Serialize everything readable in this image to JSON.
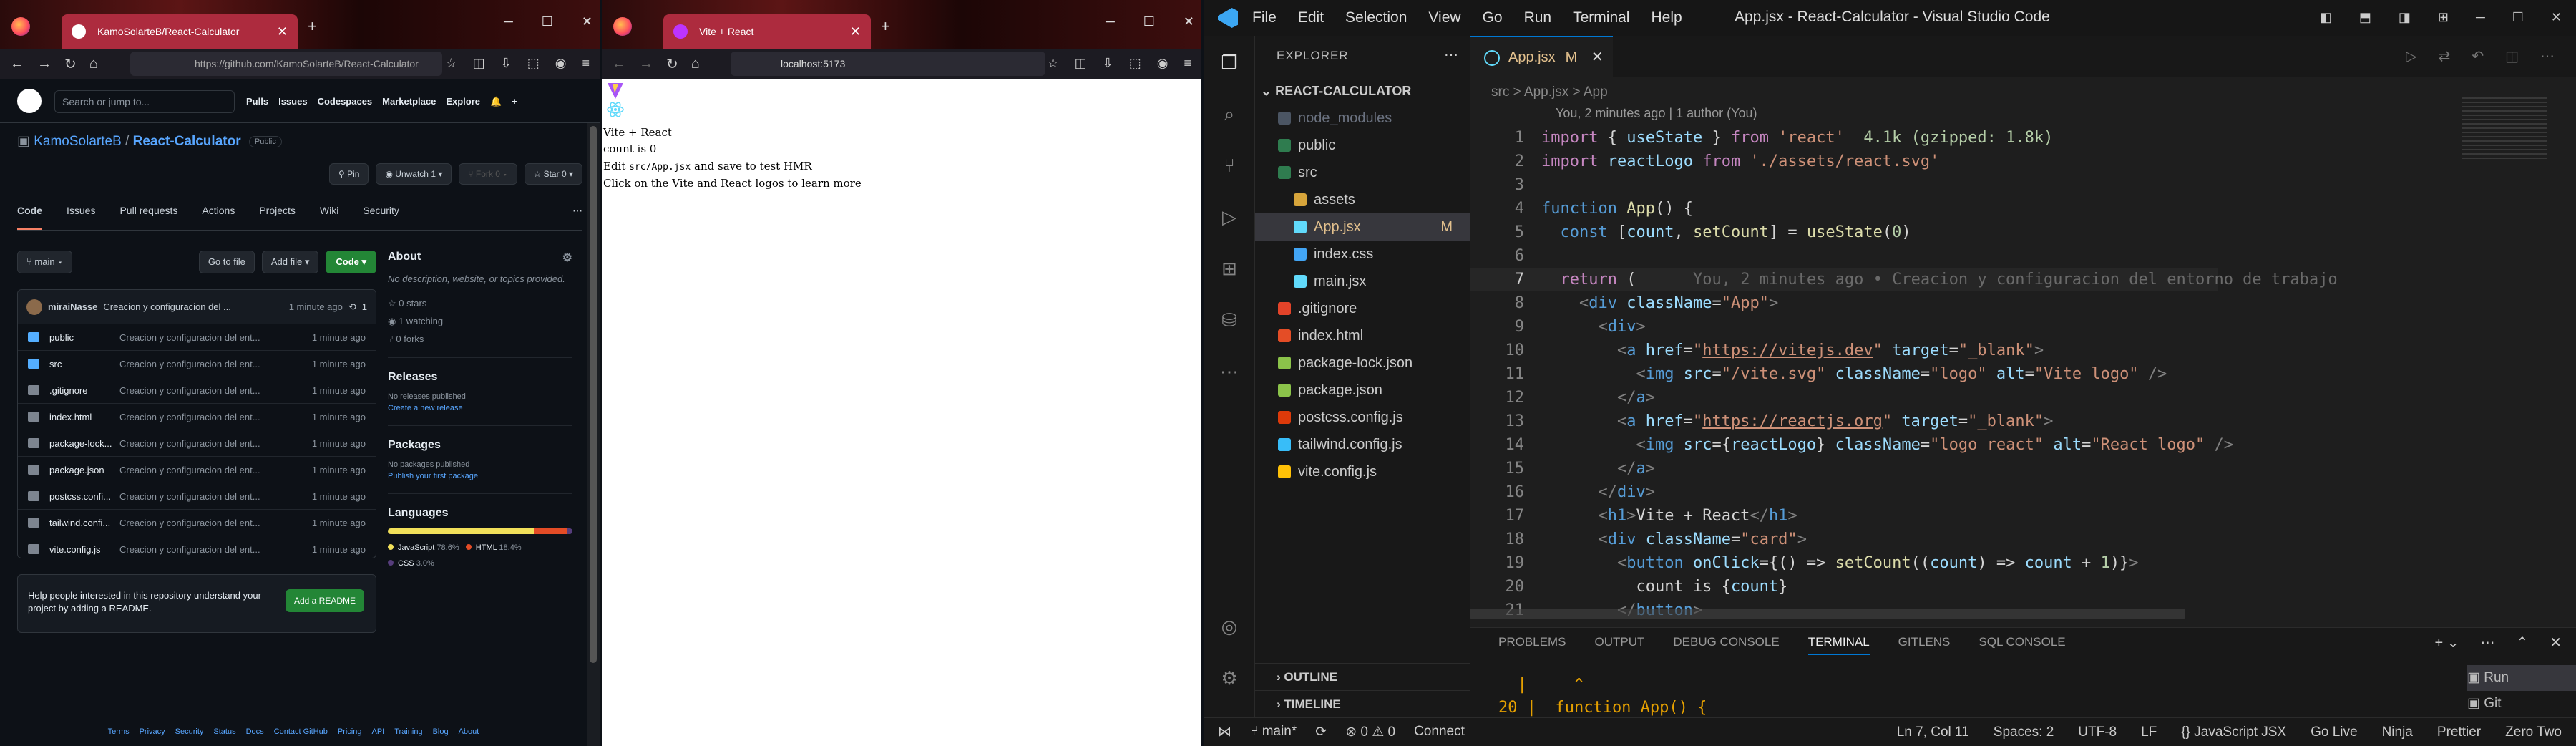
{
  "browser1": {
    "tab_title": "KamoSolarteB/React-Calculator",
    "url": "https://github.com/KamoSolarteB/React-Calculator",
    "github": {
      "search_placeholder": "Search or jump to...",
      "nav": [
        "Pulls",
        "Issues",
        "Codespaces",
        "Marketplace",
        "Explore"
      ],
      "owner": "KamoSolarteB",
      "sep": " / ",
      "repo": "React-Calculator",
      "visibility": "Public",
      "pin": "Pin",
      "unwatch": "Unwatch",
      "unwatch_count": "1",
      "fork": "Fork",
      "fork_count": "0",
      "star": "Star",
      "star_count": "0",
      "tabs": [
        "Code",
        "Issues",
        "Pull requests",
        "Actions",
        "Projects",
        "Wiki",
        "Security"
      ],
      "branch": "main",
      "go_to_file": "Go to file",
      "add_file": "Add file",
      "code_btn": "Code",
      "commit_author": "miraiNasse",
      "commit_msg": "Creacion y configuracion del ...",
      "commit_time": "1 minute ago",
      "commit_count": "1",
      "files": [
        {
          "name": "public",
          "msg": "Creacion y configuracion del ent...",
          "time": "1 minute ago",
          "dir": true
        },
        {
          "name": "src",
          "msg": "Creacion y configuracion del ent...",
          "time": "1 minute ago",
          "dir": true
        },
        {
          "name": ".gitignore",
          "msg": "Creacion y configuracion del ent...",
          "time": "1 minute ago",
          "dir": false
        },
        {
          "name": "index.html",
          "msg": "Creacion y configuracion del ent...",
          "time": "1 minute ago",
          "dir": false
        },
        {
          "name": "package-lock...",
          "msg": "Creacion y configuracion del ent...",
          "time": "1 minute ago",
          "dir": false
        },
        {
          "name": "package.json",
          "msg": "Creacion y configuracion del ent...",
          "time": "1 minute ago",
          "dir": false
        },
        {
          "name": "postcss.confi...",
          "msg": "Creacion y configuracion del ent...",
          "time": "1 minute ago",
          "dir": false
        },
        {
          "name": "tailwind.confi...",
          "msg": "Creacion y configuracion del ent...",
          "time": "1 minute ago",
          "dir": false
        },
        {
          "name": "vite.config.js",
          "msg": "Creacion y configuracion del ent...",
          "time": "1 minute ago",
          "dir": false
        }
      ],
      "readme_hint": "Help people interested in this repository understand your project by adding a README.",
      "add_readme": "Add a README",
      "about_title": "About",
      "about_desc": "No description, website, or topics provided.",
      "stars": "0 stars",
      "watching": "1 watching",
      "forks": "0 forks",
      "releases_title": "Releases",
      "no_releases": "No releases published",
      "create_release": "Create a new release",
      "packages_title": "Packages",
      "no_packages": "No packages published",
      "publish_package": "Publish your first package",
      "languages_title": "Languages",
      "languages": [
        {
          "name": "JavaScript",
          "pct": "78.6%",
          "color": "#f1e05a"
        },
        {
          "name": "HTML",
          "pct": "18.4%",
          "color": "#e34c26"
        },
        {
          "name": "CSS",
          "pct": "3.0%",
          "color": "#563d7c"
        }
      ],
      "footer": [
        "Terms",
        "Privacy",
        "Security",
        "Status",
        "Docs",
        "Contact GitHub",
        "Pricing",
        "API",
        "Training",
        "Blog",
        "About"
      ]
    }
  },
  "browser2": {
    "tab_title": "Vite + React",
    "url": "localhost:5173",
    "lines": {
      "heading": "Vite + React",
      "count": "count is 0",
      "edit_pre": "Edit ",
      "edit_code": "src/App.jsx",
      "edit_post": " and save to test HMR",
      "learn": "Click on the Vite and React logos to learn more"
    }
  },
  "vscode": {
    "menu": [
      "File",
      "Edit",
      "Selection",
      "View",
      "Go",
      "Run",
      "Terminal",
      "Help"
    ],
    "title": "App.jsx - React-Calculator - Visual Studio Code",
    "explorer_label": "EXPLORER",
    "project": "REACT-CALCULATOR",
    "tree": [
      {
        "name": "node_modules",
        "indent": 1,
        "color": "#6b7280",
        "icon": "#4b5563",
        "dim": true
      },
      {
        "name": "public",
        "indent": 1,
        "color": "#cccccc",
        "icon": "#2f7c4f"
      },
      {
        "name": "src",
        "indent": 1,
        "color": "#cccccc",
        "icon": "#2f7c4f"
      },
      {
        "name": "assets",
        "indent": 2,
        "color": "#cccccc",
        "icon": "#d7a53b"
      },
      {
        "name": "App.jsx",
        "indent": 2,
        "color": "#e2c08d",
        "icon": "#61dafb",
        "mark": "M",
        "sel": true
      },
      {
        "name": "index.css",
        "indent": 2,
        "color": "#cccccc",
        "icon": "#42a5f5"
      },
      {
        "name": "main.jsx",
        "indent": 2,
        "color": "#cccccc",
        "icon": "#61dafb"
      },
      {
        "name": ".gitignore",
        "indent": 1,
        "color": "#cccccc",
        "icon": "#e24329"
      },
      {
        "name": "index.html",
        "indent": 1,
        "color": "#cccccc",
        "icon": "#e44d26"
      },
      {
        "name": "package-lock.json",
        "indent": 1,
        "color": "#cccccc",
        "icon": "#8bc34a"
      },
      {
        "name": "package.json",
        "indent": 1,
        "color": "#cccccc",
        "icon": "#8bc34a"
      },
      {
        "name": "postcss.config.js",
        "indent": 1,
        "color": "#cccccc",
        "icon": "#dd3a0a"
      },
      {
        "name": "tailwind.config.js",
        "indent": 1,
        "color": "#cccccc",
        "icon": "#38bdf8"
      },
      {
        "name": "vite.config.js",
        "indent": 1,
        "color": "#cccccc",
        "icon": "#ffc107"
      }
    ],
    "outline": "OUTLINE",
    "timeline": "TIMELINE",
    "tab": "App.jsx",
    "tab_mark": "M",
    "breadcrumb": "src  >  App.jsx  >  App",
    "blame": "You, 2 minutes ago | 1 author (You)",
    "import_hint": "4.1k (gzipped: 1.8k)",
    "inline_blame": "You, 2 minutes ago • Creacion y configuracion del entorno de trabajo",
    "panel_tabs": [
      "PROBLEMS",
      "OUTPUT",
      "DEBUG CONSOLE",
      "TERMINAL",
      "GITLENS",
      "SQL CONSOLE"
    ],
    "terminal_line1": "  |     ^",
    "terminal_line2": "20 |  function App() {",
    "run_items": [
      "Run",
      "Git"
    ],
    "status_left": [
      "main*",
      "⊗ 0 ⚠ 0",
      "Connect"
    ],
    "status_right": [
      "Ln 7, Col 11",
      "Spaces: 2",
      "UTF-8",
      "LF",
      "{} JavaScript JSX",
      "Go Live",
      "Ninja",
      "Prettier",
      "Zero Two"
    ]
  }
}
